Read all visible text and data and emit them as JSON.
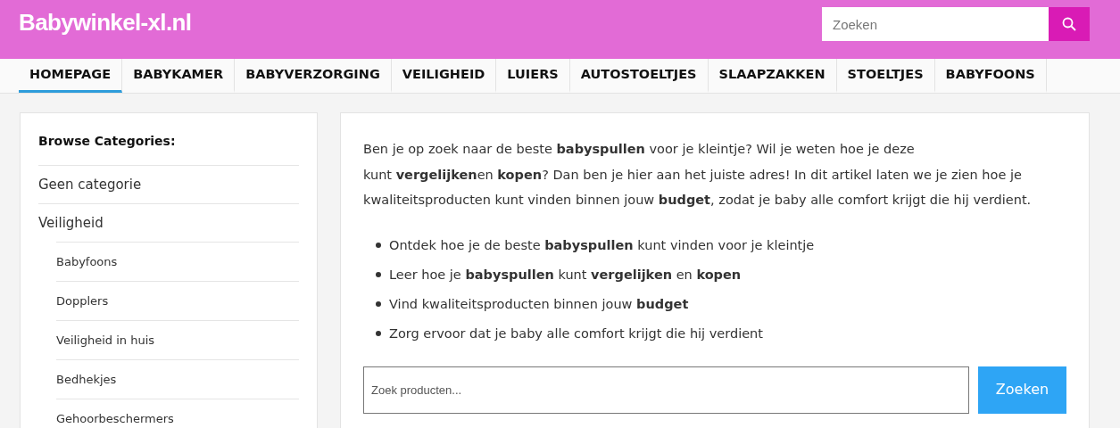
{
  "header": {
    "logo": "Babywinkel-xl.nl",
    "search": {
      "placeholder": "Zoeken"
    }
  },
  "nav": [
    {
      "label": "HOMEPAGE",
      "selected": true
    },
    {
      "label": "BABYKAMER",
      "selected": false
    },
    {
      "label": "BABYVERZORGING",
      "selected": false
    },
    {
      "label": "VEILIGHEID",
      "selected": false
    },
    {
      "label": "LUIERS",
      "selected": false
    },
    {
      "label": "AUTOSTOELTJES",
      "selected": false
    },
    {
      "label": "SLAAPZAKKEN",
      "selected": false
    },
    {
      "label": "STOELTJES",
      "selected": false
    },
    {
      "label": "BABYFOONS",
      "selected": false
    }
  ],
  "sidebar": {
    "title": "Browse Categories:",
    "items": [
      {
        "label": "Geen categorie"
      },
      {
        "label": "Veiligheid",
        "children": [
          {
            "label": "Babyfoons"
          },
          {
            "label": "Dopplers"
          },
          {
            "label": "Veiligheid in huis"
          },
          {
            "label": "Bedhekjes"
          },
          {
            "label": "Gehoorbeschermers"
          }
        ]
      }
    ]
  },
  "article": {
    "intro_lines": [
      "Ben je op zoek naar de beste **babyspullen** voor je kleintje? Wil je weten hoe je deze",
      "kunt **vergelijken**en **kopen**? Dan ben je hier aan het juiste adres! In dit artikel laten we je zien hoe je",
      "kwaliteitsproducten kunt vinden binnen jouw **budget**, zodat je baby alle comfort krijgt die hij verdient."
    ],
    "bullets": [
      "Ontdek hoe je de beste **babyspullen** kunt vinden voor je kleintje",
      "Leer hoe je **babyspullen** kunt **vergelijken** en **kopen**",
      "Vind kwaliteitsproducten binnen jouw **budget**",
      "Zorg ervoor dat je baby alle comfort krijgt die hij verdient"
    ],
    "product_search": {
      "placeholder": "Zoek producten...",
      "button": "Zoeken"
    }
  }
}
